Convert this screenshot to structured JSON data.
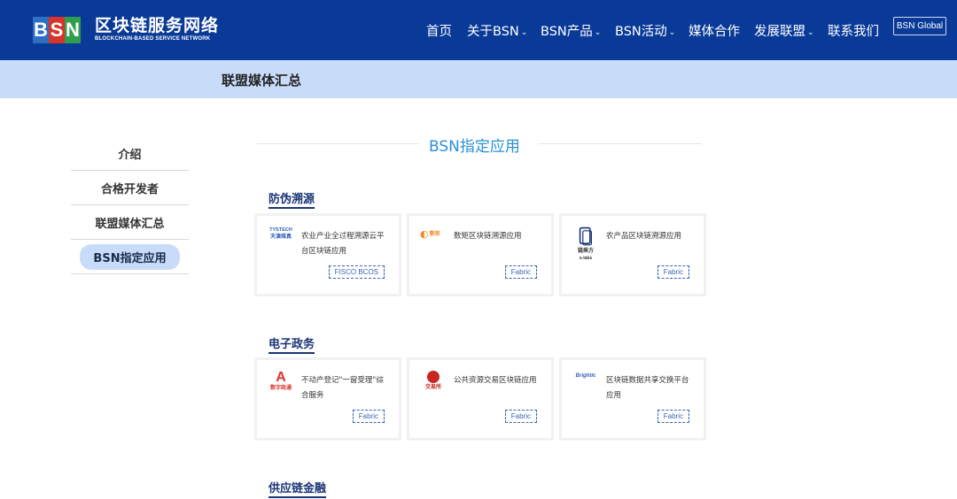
{
  "header": {
    "logo_letters": [
      "B",
      "S",
      "N"
    ],
    "logo_cn": "区块链服务网络",
    "logo_en": "BLOCKCHAIN-BASED SERVICE NETWORK",
    "nav": [
      {
        "label": "首页",
        "dropdown": false
      },
      {
        "label": "关于BSN",
        "dropdown": true
      },
      {
        "label": "BSN产品",
        "dropdown": true
      },
      {
        "label": "BSN活动",
        "dropdown": true
      },
      {
        "label": "媒体合作",
        "dropdown": false
      },
      {
        "label": "发展联盟",
        "dropdown": true
      },
      {
        "label": "联系我们",
        "dropdown": false
      }
    ],
    "global_button": "BSN Global"
  },
  "subbar": {
    "title": "联盟媒体汇总"
  },
  "sidebar": {
    "items": [
      {
        "label": "介绍",
        "active": false
      },
      {
        "label": "合格开发者",
        "active": false
      },
      {
        "label": "联盟媒体汇总",
        "active": false
      },
      {
        "label": "BSN指定应用",
        "active": true
      }
    ]
  },
  "main": {
    "section_title": "BSN指定应用",
    "categories": [
      {
        "title": "防伪溯源",
        "cards": [
          {
            "logo_text": [
              "TYSTECH",
              "天演维真"
            ],
            "icon": "tianyan-logo-icon",
            "text": "农业产业全过程溯源云平台区块链应用",
            "tag": "FISCO BCOS"
          },
          {
            "logo_text": [
              "数矩"
            ],
            "icon": "shuju-logo-icon",
            "text": "数矩区块链溯源应用",
            "tag": "Fabric"
          },
          {
            "logo_text": [
              "链乘方",
              "s-labs"
            ],
            "icon": "lianchengfang-logo-icon",
            "text": "农产品区块链溯源应用",
            "tag": "Fabric"
          }
        ]
      },
      {
        "title": "电子政务",
        "cards": [
          {
            "logo_text": [
              "数字政通"
            ],
            "icon": "shuzizhengtong-logo-icon",
            "text": "不动产登记\"一窗受理\"综合服务",
            "tag": "Fabric"
          },
          {
            "logo_text": [
              "交易所"
            ],
            "icon": "jiaoyisuo-logo-icon",
            "text": "公共资源交易区块链应用",
            "tag": "Fabric"
          },
          {
            "logo_text": [
              "Brightic"
            ],
            "icon": "brightic-logo-icon",
            "text": "区块链数据共享交换平台应用",
            "tag": "Fabric"
          }
        ]
      },
      {
        "title": "供应链金融",
        "cards": []
      }
    ]
  },
  "colors": {
    "header_bg": "#0a3a98",
    "subbar_bg": "#c8dcfa",
    "section_title": "#2a8fd8",
    "category_title": "#1a3576",
    "tag": "#3a64b8"
  }
}
